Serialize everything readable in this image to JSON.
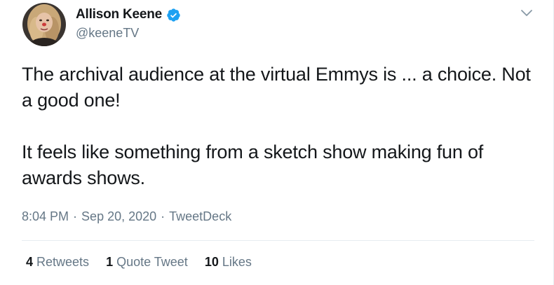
{
  "user": {
    "display_name": "Allison Keene",
    "handle": "@keeneTV",
    "verified": true,
    "avatar_icon": "profile-photo"
  },
  "tweet": {
    "paragraphs": [
      "The archival audience at the virtual Emmys is ... a choice. Not a good one!",
      "It feels like something from a sketch show making fun of awards shows."
    ]
  },
  "meta": {
    "time": "8:04 PM",
    "separator": "·",
    "date": "Sep 20, 2020",
    "source": "TweetDeck"
  },
  "stats": {
    "retweets_count": "4",
    "retweets_label": "Retweets",
    "quote_count": "1",
    "quote_label": "Quote Tweet",
    "likes_count": "10",
    "likes_label": "Likes"
  },
  "colors": {
    "text": "#14171a",
    "muted": "#657786",
    "verified": "#1da1f2",
    "border": "#e6ecf0"
  },
  "icons": {
    "verified": "verified-badge-icon",
    "caret": "chevron-down-icon"
  }
}
